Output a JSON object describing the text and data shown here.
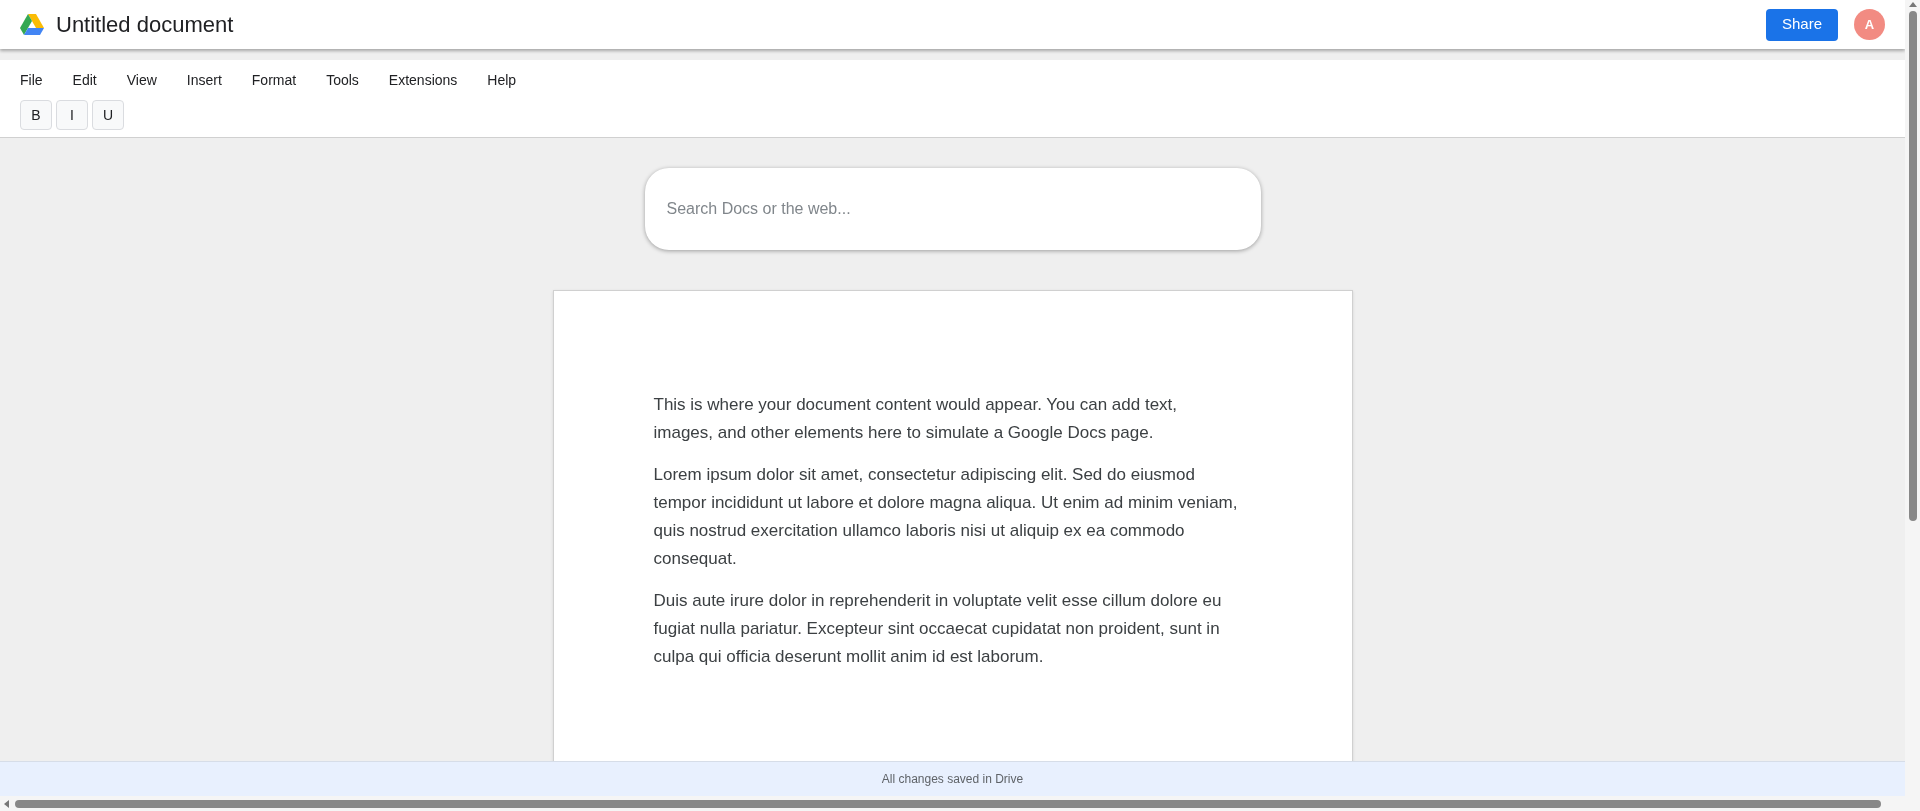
{
  "header": {
    "title": "Untitled document",
    "share_button": "Share",
    "avatar": "A"
  },
  "menu": [
    "File",
    "Edit",
    "View",
    "Insert",
    "Format",
    "Tools",
    "Extensions",
    "Help"
  ],
  "format_buttons": [
    "B",
    "I",
    "U"
  ],
  "search": {
    "placeholder": "Search Docs or the web..."
  },
  "document": {
    "paragraphs": [
      "This is where your document content would appear. You can add text, images, and other elements here to simulate a Google Docs page.",
      "Lorem ipsum dolor sit amet, consectetur adipiscing elit. Sed do eiusmod tempor incididunt ut labore et dolore magna aliqua. Ut enim ad minim veniam, quis nostrud exercitation ullamco laboris nisi ut aliquip ex ea commodo consequat.",
      "Duis aute irure dolor in reprehenderit in voluptate velit esse cillum dolore eu fugiat nulla pariatur. Excepteur sint occaecat cupidatat non proident, sunt in culpa qui officia deserunt mollit anim id est laborum."
    ]
  },
  "status_bar": "All changes saved in Drive"
}
